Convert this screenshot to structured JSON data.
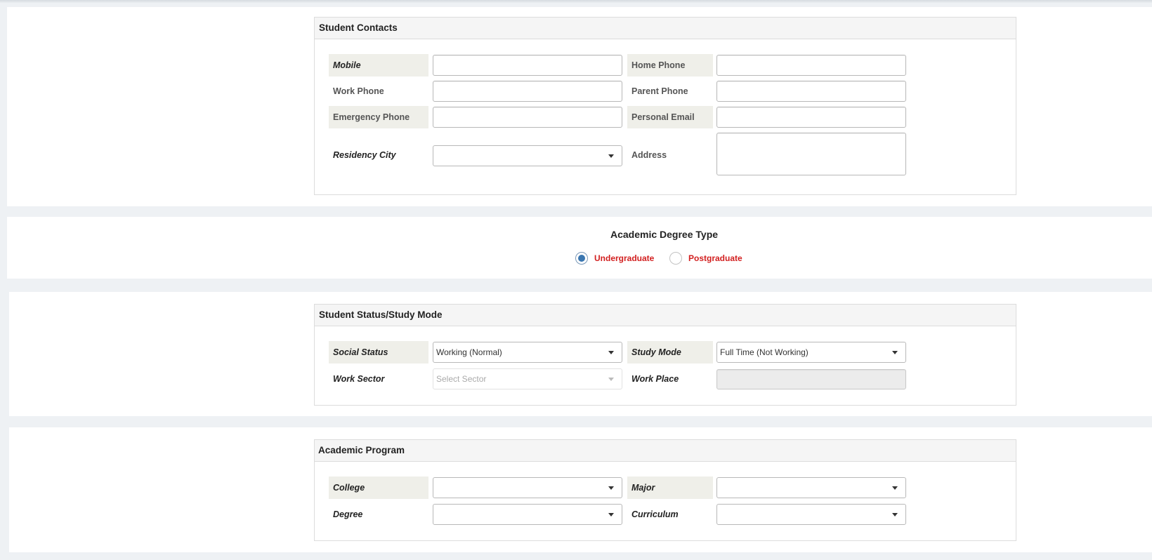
{
  "student_contacts": {
    "title": "Student Contacts",
    "mobile_label": "Mobile",
    "mobile_value": "",
    "home_phone_label": "Home Phone",
    "home_phone_value": "",
    "work_phone_label": "Work Phone",
    "work_phone_value": "",
    "parent_phone_label": "Parent Phone",
    "parent_phone_value": "",
    "emergency_phone_label": "Emergency Phone",
    "emergency_phone_value": "",
    "personal_email_label": "Personal Email",
    "personal_email_value": "",
    "residency_city_label": "Residency City",
    "residency_city_value": "",
    "address_label": "Address",
    "address_value": ""
  },
  "academic_degree": {
    "title": "Academic Degree Type",
    "options": [
      {
        "label": "Undergraduate",
        "checked": true
      },
      {
        "label": "Postgraduate",
        "checked": false
      }
    ]
  },
  "status_mode": {
    "title": "Student Status/Study Mode",
    "social_status_label": "Social Status",
    "social_status_value": "Working (Normal)",
    "study_mode_label": "Study Mode",
    "study_mode_value": "Full Time (Not Working)",
    "work_sector_label": "Work Sector",
    "work_sector_placeholder": "Select Sector",
    "work_place_label": "Work Place",
    "work_place_value": ""
  },
  "academic_program": {
    "title": "Academic Program",
    "college_label": "College",
    "college_value": "",
    "major_label": "Major",
    "major_value": "",
    "degree_label": "Degree",
    "degree_value": "",
    "curriculum_label": "Curriculum",
    "curriculum_value": ""
  },
  "colors": {
    "page_bg": "#eef1f4",
    "label_shade": "#efefe9",
    "radio_label": "#d21f1f",
    "radio_checked": "#3a76b0"
  }
}
